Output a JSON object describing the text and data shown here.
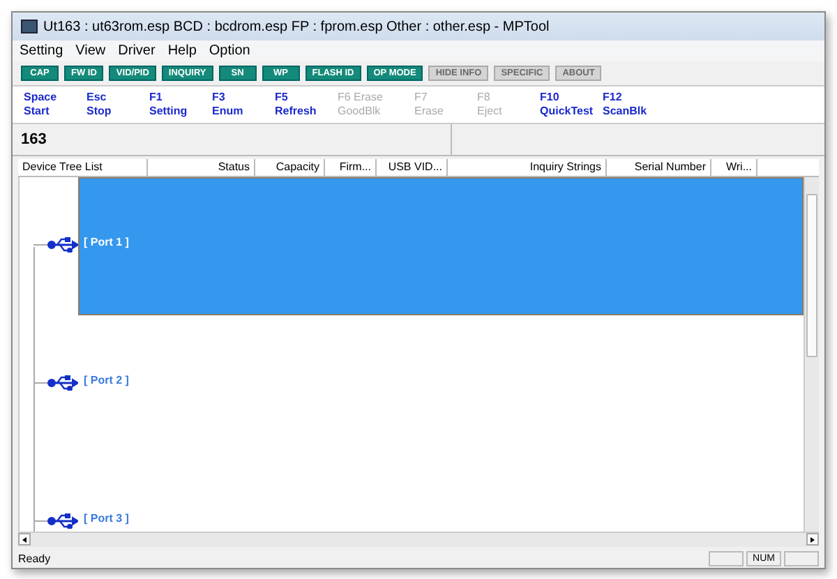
{
  "window": {
    "title": "Ut163 : ut63rom.esp BCD : bcdrom.esp FP : fprom.esp Other : other.esp - MPTool"
  },
  "menu": [
    "Setting",
    "View",
    "Driver",
    "Help",
    "Option"
  ],
  "toolbar": [
    {
      "label": "CAP",
      "disabled": false
    },
    {
      "label": "FW ID",
      "disabled": false
    },
    {
      "label": "VID/PID",
      "disabled": false
    },
    {
      "label": "INQUIRY",
      "disabled": false
    },
    {
      "label": "SN",
      "disabled": false
    },
    {
      "label": "WP",
      "disabled": false
    },
    {
      "label": "FLASH ID",
      "disabled": false
    },
    {
      "label": "OP MODE",
      "disabled": false
    },
    {
      "label": "HIDE INFO",
      "disabled": true
    },
    {
      "label": "SPECIFIC",
      "disabled": true
    },
    {
      "label": "ABOUT",
      "disabled": true
    }
  ],
  "hotkeys": [
    {
      "key": "Space",
      "action": "Start",
      "disabled": false
    },
    {
      "key": "Esc",
      "action": "Stop",
      "disabled": false
    },
    {
      "key": "F1",
      "action": "Setting",
      "disabled": false
    },
    {
      "key": "F3",
      "action": "Enum",
      "disabled": false
    },
    {
      "key": "F5",
      "action": "Refresh",
      "disabled": false
    },
    {
      "key": "F6 Erase",
      "action": "GoodBlk",
      "disabled": true
    },
    {
      "key": "F7",
      "action": "Erase",
      "disabled": true
    },
    {
      "key": "F8",
      "action": "Eject",
      "disabled": true
    },
    {
      "key": "F10",
      "action": "QuickTest",
      "disabled": false
    },
    {
      "key": "F12",
      "action": "ScanBlk",
      "disabled": false
    }
  ],
  "counter": "163",
  "table": {
    "columns": [
      "Device Tree List",
      "Status",
      "Capacity",
      "Firm...",
      "USB VID...",
      "Inquiry Strings",
      "Serial Number",
      "Wri..."
    ],
    "rows": [
      {
        "label": "[ Port  1 ]",
        "selected": true
      },
      {
        "label": "[ Port  2 ]",
        "selected": false
      },
      {
        "label": "[ Port  3 ]",
        "selected": false
      }
    ]
  },
  "status_bar": {
    "text": "Ready",
    "indicator": "NUM"
  }
}
